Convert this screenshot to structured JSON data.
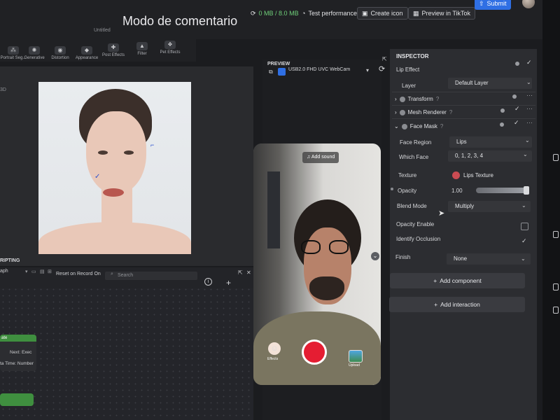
{
  "header": {
    "title": "Modo de comentario",
    "subtitle": "Untitled",
    "memory": "0 MB / 8.0 MB",
    "test_performance": "Test performance",
    "create_icon": "Create icon",
    "preview_tiktok": "Preview in TikTok",
    "submit": "Submit"
  },
  "toolbar": {
    "items": [
      {
        "label": "Portrait Seg..."
      },
      {
        "label": "Generative"
      },
      {
        "label": "Distortion"
      },
      {
        "label": "Appearance"
      },
      {
        "label": "Post Effects"
      },
      {
        "label": "Filter"
      },
      {
        "label": "Pet Effects"
      }
    ]
  },
  "scene": {
    "label_3d": "3D"
  },
  "scripting": {
    "title": "RIPTING",
    "graph_select": "aph",
    "reset_option": "Reset on Record On",
    "search_placeholder": "Search",
    "node": {
      "next_exec": "Next: Exec",
      "time_label": "ta Time: Number",
      "title": "ate"
    }
  },
  "preview": {
    "label": "PREVIEW",
    "camera": "USB2.0 FHD UVC WebCam",
    "add_sound": "Add sound",
    "effects": "Effects",
    "upload": "Upload"
  },
  "inspector": {
    "title": "INSPECTOR",
    "object_name": "Lip Effect",
    "layer_label": "Layer",
    "layer_value": "Default Layer",
    "sections": {
      "transform": "Transform",
      "mesh_renderer": "Mesh Renderer",
      "face_mask": "Face Mask"
    },
    "face_region_label": "Face Region",
    "face_region_value": "Lips",
    "which_face_label": "Which Face",
    "which_face_value": "0, 1, 2, 3, 4",
    "texture_label": "Texture",
    "texture_value": "Lips Texture",
    "opacity_label": "Opacity",
    "opacity_value": "1.00",
    "blend_mode_label": "Blend Mode",
    "blend_mode_value": "Multiply",
    "opacity_enable_label": "Opacity Enable",
    "identify_occlusion_label": "Identify Occlusion",
    "finish_label": "Finish",
    "finish_value": "None",
    "add_component": "Add component",
    "add_interaction": "Add interaction"
  }
}
